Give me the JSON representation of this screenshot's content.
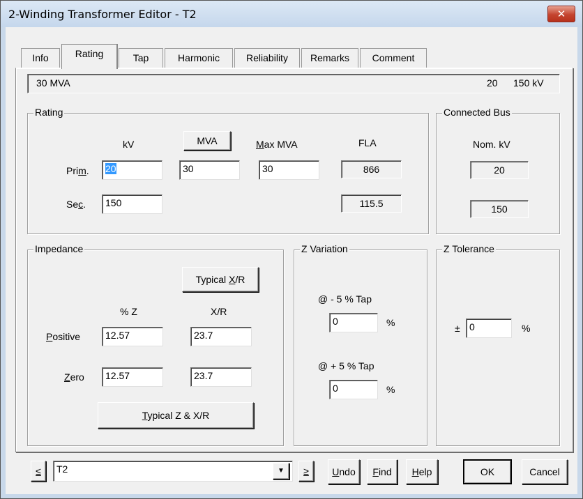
{
  "window": {
    "title": "2-Winding Transformer Editor - T2",
    "close_glyph": "✕"
  },
  "tabs": [
    {
      "label": "Info"
    },
    {
      "label": "Rating"
    },
    {
      "label": "Tap"
    },
    {
      "label": "Harmonic"
    },
    {
      "label": "Reliability"
    },
    {
      "label": "Remarks"
    },
    {
      "label": "Comment"
    }
  ],
  "active_tab": "Rating",
  "summary": {
    "mva": "30 MVA",
    "kv_prim": "20",
    "kv_sec": "150 kV"
  },
  "rating": {
    "group_label": "Rating",
    "kv_header": "kV",
    "mva_button": "MVA",
    "max_mva_header_u": "M",
    "max_mva_header_rest": "ax MVA",
    "fla_header": "FLA",
    "prim_label_pre": "Pri",
    "prim_label_u": "m",
    "prim_label_post": ".",
    "sec_label_pre": "Se",
    "sec_label_u": "c",
    "sec_label_post": ".",
    "prim_kv": "20",
    "prim_mva": "30",
    "prim_max_mva": "30",
    "prim_fla": "866",
    "sec_kv": "150",
    "sec_fla": "115.5"
  },
  "connected_bus": {
    "group_label": "Connected Bus",
    "nom_kv_header": "Nom. kV",
    "prim_kv": "20",
    "sec_kv": "150"
  },
  "impedance": {
    "group_label": "Impedance",
    "typical_xr_pre": "Typical ",
    "typical_xr_u": "X",
    "typical_xr_post": "/R",
    "z_header": "% Z",
    "xr_header": "X/R",
    "positive_u": "P",
    "positive_rest": "ositive",
    "zero_u": "Z",
    "zero_rest": "ero",
    "pos_z": "12.57",
    "pos_xr": "23.7",
    "zero_z": "12.57",
    "zero_xr": "23.7",
    "typical_zxr_u": "T",
    "typical_zxr_rest": "ypical Z & X/R"
  },
  "z_variation": {
    "group_label": "Z Variation",
    "minus_label": "@ - 5 % Tap",
    "minus_value": "0",
    "plus_label": "@ + 5 % Tap",
    "plus_value": "0",
    "unit": "%"
  },
  "z_tolerance": {
    "group_label": "Z Tolerance",
    "plus_minus": "±",
    "value": "0",
    "unit": "%"
  },
  "footer": {
    "prev_glyph": "≤",
    "next_glyph": "≥",
    "selector_value": "T2",
    "undo_u": "U",
    "undo_rest": "ndo",
    "find_u": "F",
    "find_rest": "ind",
    "help_u": "H",
    "help_rest": "elp",
    "ok": "OK",
    "cancel": "Cancel"
  }
}
